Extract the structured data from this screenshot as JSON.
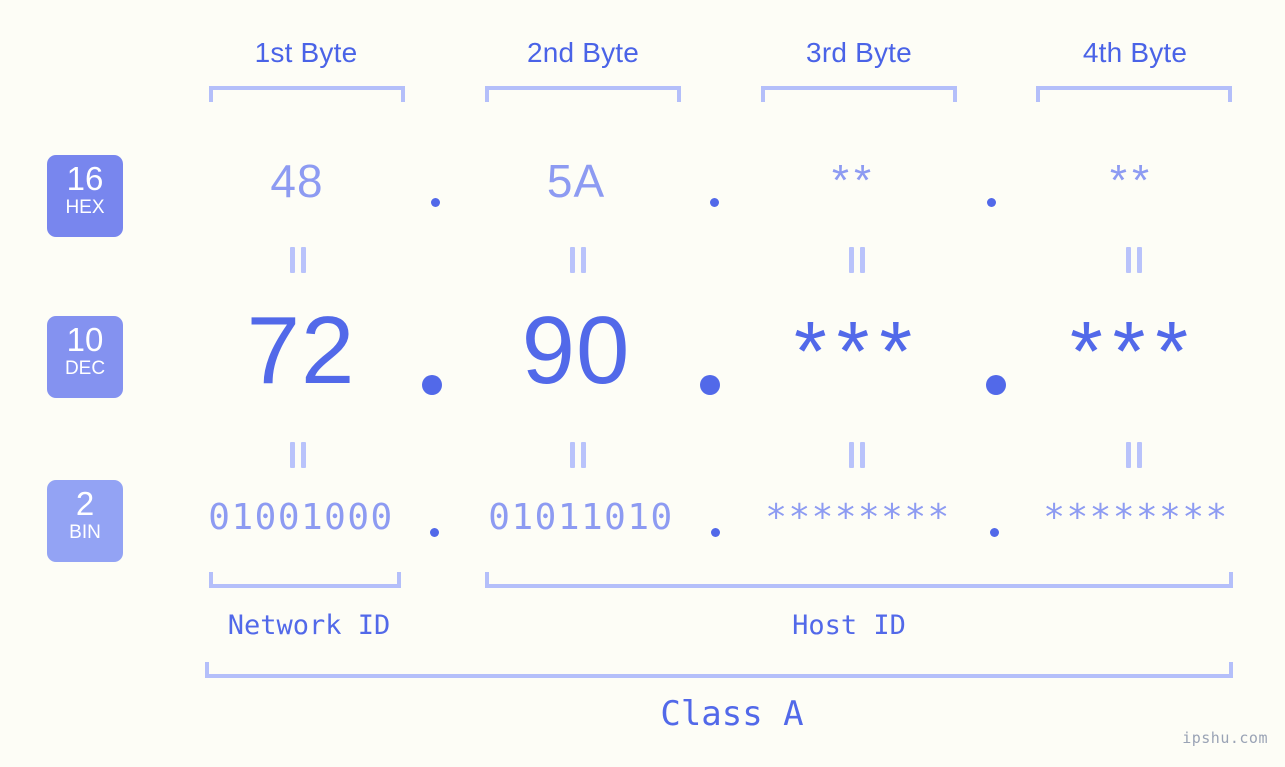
{
  "meta": {
    "watermark": "ipshu.com",
    "background_color": "#fdfdf6",
    "accent_strong": "#5269e9",
    "accent_mid": "#8d9bf2",
    "accent_light": "#b4bffa"
  },
  "headers": {
    "byte1": "1st Byte",
    "byte2": "2nd Byte",
    "byte3": "3rd Byte",
    "byte4": "4th Byte"
  },
  "bases": [
    {
      "num": "16",
      "name": "HEX",
      "color": "#7886ee"
    },
    {
      "num": "10",
      "name": "DEC",
      "color": "#8492f0"
    },
    {
      "num": "2",
      "name": "BIN",
      "color": "#93a3f4"
    }
  ],
  "rows": {
    "hex": {
      "label_num": "16",
      "label_name": "HEX",
      "values": [
        "48",
        "5A",
        "**",
        "**"
      ],
      "separators": [
        ".",
        ".",
        "."
      ]
    },
    "dec": {
      "label_num": "10",
      "label_name": "DEC",
      "values": [
        "72",
        "90",
        "***",
        "***"
      ],
      "separators": [
        ".",
        ".",
        "."
      ]
    },
    "bin": {
      "label_num": "2",
      "label_name": "BIN",
      "values": [
        "01001000",
        "01011010",
        "********",
        "********"
      ],
      "separators": [
        ".",
        ".",
        "."
      ]
    }
  },
  "connectors": {
    "glyph": "||",
    "meaning": "equals"
  },
  "sections": {
    "network_id": "Network ID",
    "host_id": "Host ID",
    "class": "Class A"
  }
}
